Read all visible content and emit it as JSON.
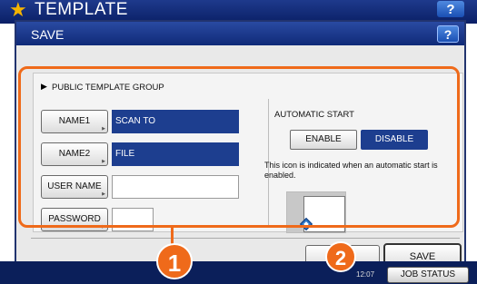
{
  "background_screen": {
    "title": "TEMPLATE",
    "help_label": "?"
  },
  "dialog": {
    "title": "SAVE",
    "help_label": "?"
  },
  "public_group": {
    "label": "PUBLIC TEMPLATE GROUP"
  },
  "form": {
    "name1": {
      "button_label": "NAME1",
      "value": "SCAN TO"
    },
    "name2": {
      "button_label": "NAME2",
      "value": "FILE"
    },
    "user_name": {
      "button_label": "USER NAME",
      "value": ""
    },
    "password": {
      "button_label": "PASSWORD",
      "value": ""
    }
  },
  "automatic_start": {
    "label": "AUTOMATIC START",
    "enable_label": "ENABLE",
    "disable_label": "DISABLE",
    "selected": "DISABLE",
    "note": "This icon is indicated when an automatic start is enabled."
  },
  "actions": {
    "save_label": "SAVE"
  },
  "status_bar": {
    "clock": "12:07",
    "job_status_label": "JOB STATUS"
  },
  "callouts": {
    "one": "1",
    "two": "2"
  },
  "colors": {
    "accent_orange": "#ef6a1a",
    "title_bar_blue": "#1d3e8f",
    "selected_blue": "#1d3e8f"
  }
}
